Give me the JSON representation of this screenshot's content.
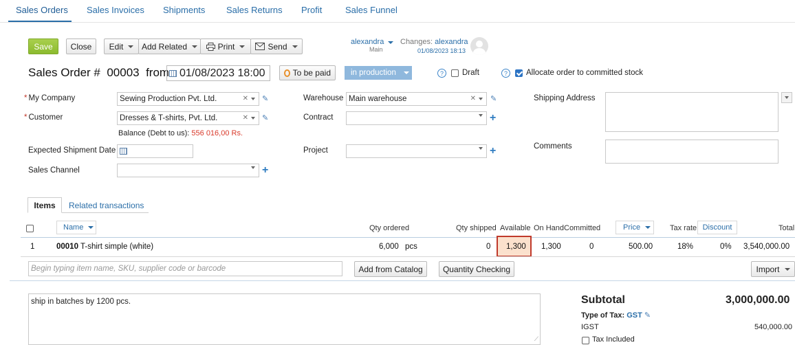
{
  "tabs": [
    "Sales Orders",
    "Sales Invoices",
    "Shipments",
    "Sales Returns",
    "Profit",
    "Sales Funnel"
  ],
  "toolbar": {
    "save": "Save",
    "close": "Close",
    "edit": "Edit",
    "add_related": "Add Related",
    "print": "Print",
    "send": "Send",
    "user": "alexandra",
    "user_sub": "Main",
    "changes_label": "Changes:",
    "changes_user": "alexandra",
    "changes_time": "01/08/2023 18:13"
  },
  "header": {
    "title": "Sales Order #",
    "number": "00003",
    "from": "from",
    "date": "01/08/2023 18:00",
    "payment_status": "To be paid",
    "status": "in production",
    "draft": "Draft",
    "allocate": "Allocate order to committed stock"
  },
  "form": {
    "my_company_label": "My Company",
    "my_company": "Sewing Production Pvt. Ltd.",
    "customer_label": "Customer",
    "customer": "Dresses & T-shirts, Pvt. Ltd.",
    "balance_label": "Balance (Debt to us):",
    "balance_value": "556 016,00 Rs.",
    "expected_shipment_label": "Expected Shipment Date",
    "sales_channel_label": "Sales Channel",
    "warehouse_label": "Warehouse",
    "warehouse": "Main warehouse",
    "contract_label": "Contract",
    "project_label": "Project",
    "shipping_address_label": "Shipping Address",
    "comments_label": "Comments"
  },
  "items_tabs": [
    "Items",
    "Related transactions"
  ],
  "items": {
    "headers": {
      "name": "Name",
      "qty_ordered": "Qty ordered",
      "qty_shipped": "Qty shipped",
      "available": "Available",
      "on_hand": "On Hand",
      "committed": "Committed",
      "price": "Price",
      "tax_rate": "Tax rate",
      "discount": "Discount",
      "total": "Total"
    },
    "rows": [
      {
        "num": "1",
        "sku": "00010",
        "name": "T-shirt simple (white)",
        "qty": "6,000",
        "unit": "pcs",
        "shipped": "0",
        "available": "1,300",
        "on_hand": "1,300",
        "committed": "0",
        "price": "500.00",
        "tax": "18%",
        "discount": "0%",
        "total": "3,540,000.00"
      }
    ],
    "search_placeholder": "Begin typing item name, SKU, supplier code or barcode",
    "add_from_catalog": "Add from Catalog",
    "quantity_checking": "Quantity Checking",
    "import": "Import"
  },
  "notes": "ship in batches by 1200 pcs.",
  "totals": {
    "subtotal_label": "Subtotal",
    "subtotal": "3,000,000.00",
    "type_of_tax_label": "Type of Tax:",
    "type_of_tax": "GST",
    "igst_label": "IGST",
    "igst": "540,000.00",
    "tax_included": "Tax Included"
  },
  "colors": {
    "accent": "#2a6ea8",
    "save": "#8cbb2f",
    "status": "#8fb8dd",
    "balance": "#d93a2b",
    "highlight_border": "#c0392b"
  }
}
